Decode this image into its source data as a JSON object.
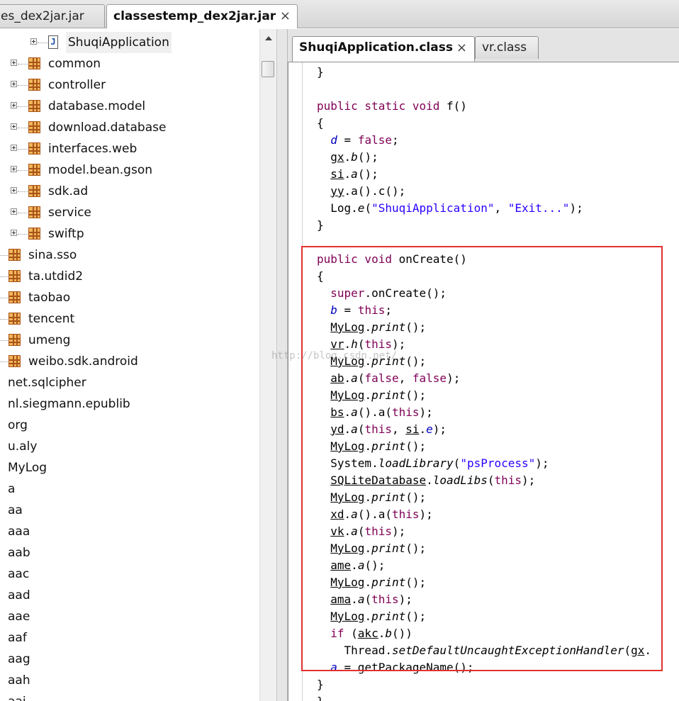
{
  "file_tabs": [
    {
      "label": "es_dex2jar.jar",
      "active": false
    },
    {
      "label": "classestemp_dex2jar.jar",
      "active": true,
      "close": "×"
    }
  ],
  "tree": {
    "items": [
      {
        "label": "ShuqiApplication",
        "icon": "java-class-icon",
        "expandable": true,
        "level": 2,
        "selected": true
      },
      {
        "label": "common",
        "icon": "package-icon",
        "expandable": true,
        "level": 1
      },
      {
        "label": "controller",
        "icon": "package-icon",
        "expandable": true,
        "level": 1
      },
      {
        "label": "database.model",
        "icon": "package-icon",
        "expandable": true,
        "level": 1
      },
      {
        "label": "download.database",
        "icon": "package-icon",
        "expandable": true,
        "level": 1
      },
      {
        "label": "interfaces.web",
        "icon": "package-icon",
        "expandable": true,
        "level": 1
      },
      {
        "label": "model.bean.gson",
        "icon": "package-icon",
        "expandable": true,
        "level": 1
      },
      {
        "label": "sdk.ad",
        "icon": "package-icon",
        "expandable": true,
        "level": 1
      },
      {
        "label": "service",
        "icon": "package-icon",
        "expandable": true,
        "level": 1
      },
      {
        "label": "swiftp",
        "icon": "package-icon",
        "expandable": true,
        "level": 1
      },
      {
        "label": "sina.sso",
        "icon": "package-icon",
        "expandable": false,
        "level": 0
      },
      {
        "label": "ta.utdid2",
        "icon": "package-icon",
        "expandable": false,
        "level": 0
      },
      {
        "label": "taobao",
        "icon": "package-icon",
        "expandable": false,
        "level": 0
      },
      {
        "label": "tencent",
        "icon": "package-icon",
        "expandable": false,
        "level": 0
      },
      {
        "label": "umeng",
        "icon": "package-icon",
        "expandable": false,
        "level": 0
      },
      {
        "label": "weibo.sdk.android",
        "icon": "package-icon",
        "expandable": false,
        "level": 0
      },
      {
        "label": "net.sqlcipher",
        "level": -1
      },
      {
        "label": "nl.siegmann.epublib",
        "level": -1
      },
      {
        "label": "org",
        "level": -1
      },
      {
        "label": "u.aly",
        "level": -1
      },
      {
        "label": "MyLog",
        "level": -1
      },
      {
        "label": "a",
        "level": -1
      },
      {
        "label": "aa",
        "level": -1
      },
      {
        "label": "aaa",
        "level": -1
      },
      {
        "label": "aab",
        "level": -1
      },
      {
        "label": "aac",
        "level": -1
      },
      {
        "label": "aad",
        "level": -1
      },
      {
        "label": "aae",
        "level": -1
      },
      {
        "label": "aaf",
        "level": -1
      },
      {
        "label": "aag",
        "level": -1
      },
      {
        "label": "aah",
        "level": -1
      },
      {
        "label": "aai",
        "level": -1
      }
    ]
  },
  "editor_tabs": [
    {
      "label": "ShuqiApplication.class",
      "active": true,
      "close": "×"
    },
    {
      "label": "vr.class",
      "active": false
    }
  ],
  "code_lines": [
    [
      {
        "t": "}"
      }
    ],
    [],
    [
      {
        "t": "public static void ",
        "c": "kw"
      },
      {
        "t": "f()"
      }
    ],
    [
      {
        "t": "{"
      }
    ],
    [
      {
        "t": "  "
      },
      {
        "t": "d",
        "c": "fld"
      },
      {
        "t": " = "
      },
      {
        "t": "false",
        "c": "kw"
      },
      {
        "t": ";"
      }
    ],
    [
      {
        "t": "  "
      },
      {
        "t": "gx",
        "c": "cls"
      },
      {
        "t": "."
      },
      {
        "t": "b",
        "c": "mth"
      },
      {
        "t": "();"
      }
    ],
    [
      {
        "t": "  "
      },
      {
        "t": "si",
        "c": "cls"
      },
      {
        "t": "."
      },
      {
        "t": "a",
        "c": "mth"
      },
      {
        "t": "();"
      }
    ],
    [
      {
        "t": "  "
      },
      {
        "t": "yy",
        "c": "cls"
      },
      {
        "t": ".a().c();"
      }
    ],
    [
      {
        "t": "  Log."
      },
      {
        "t": "e",
        "c": "mth"
      },
      {
        "t": "("
      },
      {
        "t": "\"ShuqiApplication\"",
        "c": "str"
      },
      {
        "t": ", "
      },
      {
        "t": "\"Exit...\"",
        "c": "str"
      },
      {
        "t": ");"
      }
    ],
    [
      {
        "t": "}"
      }
    ],
    [],
    [
      {
        "t": "public void ",
        "c": "kw"
      },
      {
        "t": "onCreate()"
      }
    ],
    [
      {
        "t": "{"
      }
    ],
    [
      {
        "t": "  "
      },
      {
        "t": "super",
        "c": "kw"
      },
      {
        "t": ".onCreate();"
      }
    ],
    [
      {
        "t": "  "
      },
      {
        "t": "b",
        "c": "fld"
      },
      {
        "t": " = "
      },
      {
        "t": "this",
        "c": "kw"
      },
      {
        "t": ";"
      }
    ],
    [
      {
        "t": "  "
      },
      {
        "t": "MyLog",
        "c": "cls"
      },
      {
        "t": "."
      },
      {
        "t": "print",
        "c": "mth"
      },
      {
        "t": "();"
      }
    ],
    [
      {
        "t": "  "
      },
      {
        "t": "vr",
        "c": "cls"
      },
      {
        "t": "."
      },
      {
        "t": "h",
        "c": "mth"
      },
      {
        "t": "("
      },
      {
        "t": "this",
        "c": "kw"
      },
      {
        "t": ");"
      }
    ],
    [
      {
        "t": "  "
      },
      {
        "t": "MyLog",
        "c": "cls"
      },
      {
        "t": "."
      },
      {
        "t": "print",
        "c": "mth"
      },
      {
        "t": "();"
      }
    ],
    [
      {
        "t": "  "
      },
      {
        "t": "ab",
        "c": "cls"
      },
      {
        "t": "."
      },
      {
        "t": "a",
        "c": "mth"
      },
      {
        "t": "("
      },
      {
        "t": "false",
        "c": "kw"
      },
      {
        "t": ", "
      },
      {
        "t": "false",
        "c": "kw"
      },
      {
        "t": ");"
      }
    ],
    [
      {
        "t": "  "
      },
      {
        "t": "MyLog",
        "c": "cls"
      },
      {
        "t": "."
      },
      {
        "t": "print",
        "c": "mth"
      },
      {
        "t": "();"
      }
    ],
    [
      {
        "t": "  "
      },
      {
        "t": "bs",
        "c": "cls"
      },
      {
        "t": "."
      },
      {
        "t": "a",
        "c": "mth"
      },
      {
        "t": "().a("
      },
      {
        "t": "this",
        "c": "kw"
      },
      {
        "t": ");"
      }
    ],
    [
      {
        "t": "  "
      },
      {
        "t": "yd",
        "c": "cls"
      },
      {
        "t": "."
      },
      {
        "t": "a",
        "c": "mth"
      },
      {
        "t": "("
      },
      {
        "t": "this",
        "c": "kw"
      },
      {
        "t": ", "
      },
      {
        "t": "si",
        "c": "cls"
      },
      {
        "t": "."
      },
      {
        "t": "e",
        "c": "fld"
      },
      {
        "t": ");"
      }
    ],
    [
      {
        "t": "  "
      },
      {
        "t": "MyLog",
        "c": "cls"
      },
      {
        "t": "."
      },
      {
        "t": "print",
        "c": "mth"
      },
      {
        "t": "();"
      }
    ],
    [
      {
        "t": "  System."
      },
      {
        "t": "loadLibrary",
        "c": "mth"
      },
      {
        "t": "("
      },
      {
        "t": "\"psProcess\"",
        "c": "str"
      },
      {
        "t": ");"
      }
    ],
    [
      {
        "t": "  "
      },
      {
        "t": "SQLiteDatabase",
        "c": "cls"
      },
      {
        "t": "."
      },
      {
        "t": "loadLibs",
        "c": "mth"
      },
      {
        "t": "("
      },
      {
        "t": "this",
        "c": "kw"
      },
      {
        "t": ");"
      }
    ],
    [
      {
        "t": "  "
      },
      {
        "t": "MyLog",
        "c": "cls"
      },
      {
        "t": "."
      },
      {
        "t": "print",
        "c": "mth"
      },
      {
        "t": "();"
      }
    ],
    [
      {
        "t": "  "
      },
      {
        "t": "xd",
        "c": "cls"
      },
      {
        "t": "."
      },
      {
        "t": "a",
        "c": "mth"
      },
      {
        "t": "().a("
      },
      {
        "t": "this",
        "c": "kw"
      },
      {
        "t": ");"
      }
    ],
    [
      {
        "t": "  "
      },
      {
        "t": "vk",
        "c": "cls"
      },
      {
        "t": "."
      },
      {
        "t": "a",
        "c": "mth"
      },
      {
        "t": "("
      },
      {
        "t": "this",
        "c": "kw"
      },
      {
        "t": ");"
      }
    ],
    [
      {
        "t": "  "
      },
      {
        "t": "MyLog",
        "c": "cls"
      },
      {
        "t": "."
      },
      {
        "t": "print",
        "c": "mth"
      },
      {
        "t": "();"
      }
    ],
    [
      {
        "t": "  "
      },
      {
        "t": "ame",
        "c": "cls"
      },
      {
        "t": "."
      },
      {
        "t": "a",
        "c": "mth"
      },
      {
        "t": "();"
      }
    ],
    [
      {
        "t": "  "
      },
      {
        "t": "MyLog",
        "c": "cls"
      },
      {
        "t": "."
      },
      {
        "t": "print",
        "c": "mth"
      },
      {
        "t": "();"
      }
    ],
    [
      {
        "t": "  "
      },
      {
        "t": "ama",
        "c": "cls"
      },
      {
        "t": "."
      },
      {
        "t": "a",
        "c": "mth"
      },
      {
        "t": "("
      },
      {
        "t": "this",
        "c": "kw"
      },
      {
        "t": ");"
      }
    ],
    [
      {
        "t": "  "
      },
      {
        "t": "MyLog",
        "c": "cls"
      },
      {
        "t": "."
      },
      {
        "t": "print",
        "c": "mth"
      },
      {
        "t": "();"
      }
    ],
    [
      {
        "t": "  "
      },
      {
        "t": "if",
        "c": "kw"
      },
      {
        "t": " ("
      },
      {
        "t": "akc",
        "c": "cls"
      },
      {
        "t": "."
      },
      {
        "t": "b",
        "c": "mth"
      },
      {
        "t": "())"
      }
    ],
    [
      {
        "t": "    Thread."
      },
      {
        "t": "setDefaultUncaughtExceptionHandler",
        "c": "mth"
      },
      {
        "t": "("
      },
      {
        "t": "gx",
        "c": "cls"
      },
      {
        "t": "."
      }
    ],
    [
      {
        "t": "  "
      },
      {
        "t": "a",
        "c": "fld"
      },
      {
        "t": " = getPackageName();"
      }
    ],
    [
      {
        "t": "}"
      }
    ],
    [
      {
        "t": "}"
      }
    ]
  ],
  "watermark": "http://blog.csdn.net/",
  "colors": {
    "keyword": "#7f0055",
    "string": "#2a00ff",
    "field": "#0000c0",
    "highlight_box": "#e0312f",
    "package_icon": "#f2b55c"
  }
}
